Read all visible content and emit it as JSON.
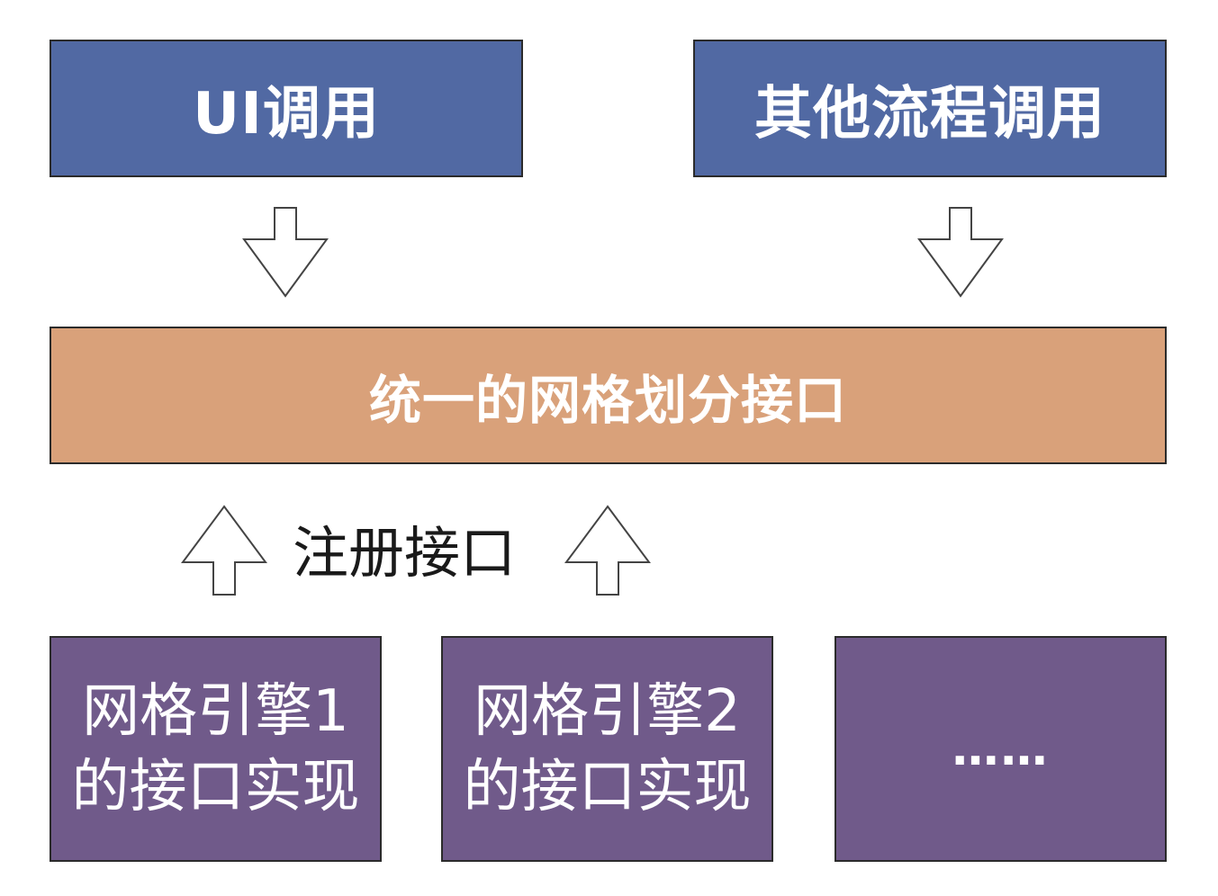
{
  "callers": {
    "ui": "UI调用",
    "other": "其他流程调用"
  },
  "unified_interface": "统一的网格划分接口",
  "register_label": "注册接口",
  "implementations": [
    "网格引擎1\n的接口实现",
    "网格引擎2\n的接口实现",
    "……"
  ],
  "colors": {
    "caller_box": "#5169a3",
    "unified_box": "#d9a17a",
    "impl_box": "#705a8a"
  },
  "icons": {
    "down_arrows": "hollow-down-arrow",
    "up_arrows": "hollow-up-arrow"
  }
}
